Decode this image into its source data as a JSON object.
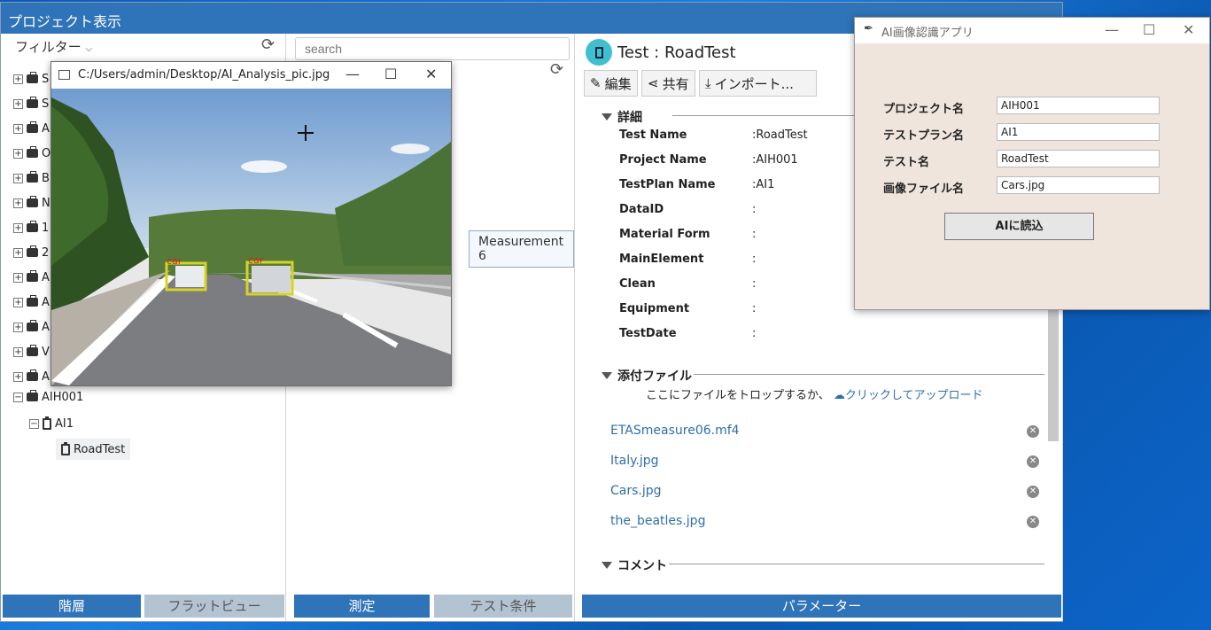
{
  "app": {
    "title": "プロジェクト表示",
    "filter_label": "フィルター",
    "tree_items": [
      "S",
      "S",
      "A",
      "O",
      "B",
      "N",
      "1",
      "2",
      "A",
      "A",
      "A",
      "V",
      "A"
    ],
    "tree_project": "AIH001",
    "tree_testplan": "AI1",
    "tree_test": "RoadTest",
    "left_tabs": [
      "階層",
      "フラットビュー"
    ],
    "mid_tabs": [
      "測定",
      "テスト条件"
    ],
    "right_tab": "パラメーター",
    "search_placeholder": "search",
    "measurement_tip": "Measurement 6"
  },
  "details": {
    "title": "Test : RoadTest",
    "toolbar": [
      "編集",
      "共有",
      "インポート..."
    ],
    "section_title": "詳細",
    "fields": [
      {
        "key": "Test Name",
        "value": ":RoadTest"
      },
      {
        "key": "Project Name",
        "value": ":AIH001"
      },
      {
        "key": "TestPlan Name",
        "value": ":AI1"
      },
      {
        "key": "DataID",
        "value": ":"
      },
      {
        "key": "Material Form",
        "value": ":"
      },
      {
        "key": "MainElement",
        "value": ":"
      },
      {
        "key": "Clean",
        "value": ":"
      },
      {
        "key": "Equipment",
        "value": ":"
      },
      {
        "key": "TestDate",
        "value": ":"
      }
    ],
    "attach_title": "添付ファイル",
    "drop_text": "ここにファイルをトロップするか、",
    "upload_link": "クリックしてアップロード",
    "files": [
      "ETASmeasure06.mf4",
      "Italy.jpg",
      "Cars.jpg",
      "the_beatles.jpg"
    ],
    "comment_title": "コメント"
  },
  "image_window": {
    "title": "C:/Users/admin/Desktop/AI_Analysis_pic.jpg",
    "detections": [
      "car",
      "car"
    ]
  },
  "ai_window": {
    "title": "AI画像認識アプリ",
    "labels": [
      "プロジェクト名",
      "テストプラン名",
      "テスト名",
      "画像ファイル名"
    ],
    "values": [
      "AIH001",
      "AI1",
      "RoadTest",
      "Cars.jpg"
    ],
    "button": "AIに読込"
  }
}
